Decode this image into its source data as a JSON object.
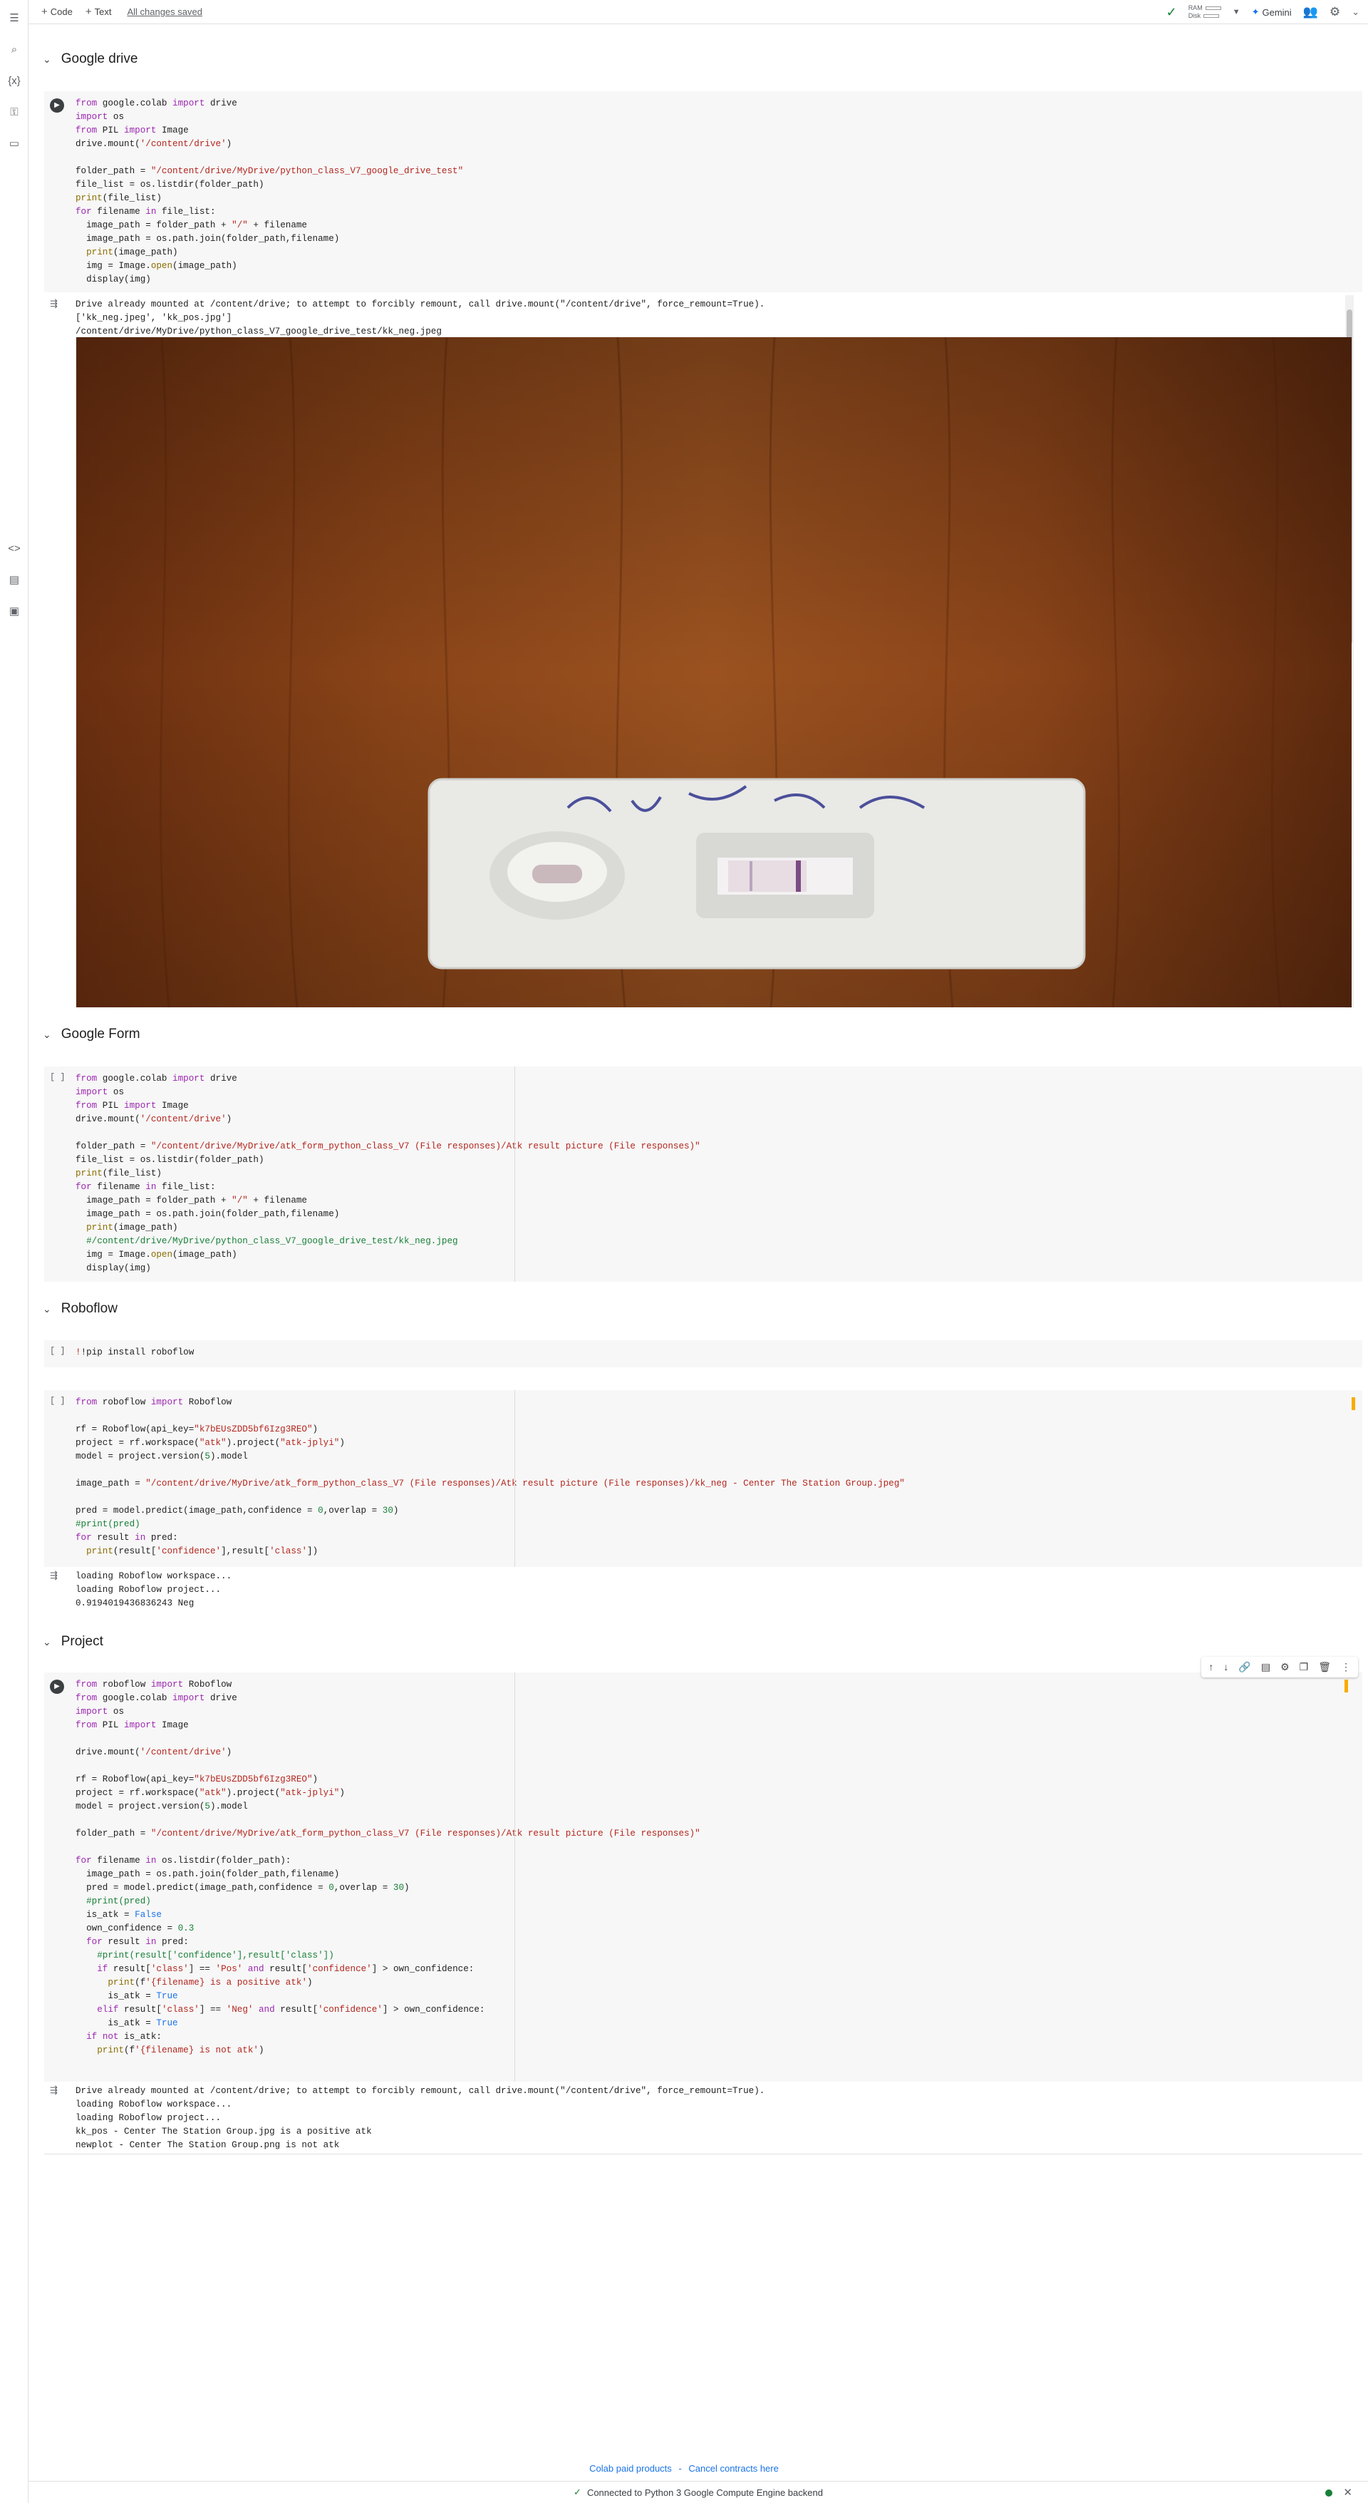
{
  "toolbar": {
    "code_label": "Code",
    "text_label": "Text",
    "saved_status": "All changes saved",
    "ram_label": "RAM",
    "disk_label": "Disk",
    "gemini_label": "Gemini"
  },
  "sections": {
    "google_drive": "Google drive",
    "google_form": "Google Form",
    "roboflow": "Roboflow",
    "project": "Project"
  },
  "cells": {
    "drive_code": [
      "from google.colab import drive",
      "import os",
      "from PIL import Image",
      "drive.mount('/content/drive')",
      "",
      "folder_path = \"/content/drive/MyDrive/python_class_V7_google_drive_test\"",
      "file_list = os.listdir(folder_path)",
      "print(file_list)",
      "for filename in file_list:",
      "  image_path = folder_path + \"/\" + filename",
      "  image_path = os.path.join(folder_path,filename)",
      "  print(image_path)",
      "  img = Image.open(image_path)",
      "  display(img)"
    ],
    "drive_output": [
      "Drive already mounted at /content/drive; to attempt to forcibly remount, call drive.mount(\"/content/drive\", force_remount=True).",
      "['kk_neg.jpeg', 'kk_pos.jpg']",
      "/content/drive/MyDrive/python_class_V7_google_drive_test/kk_neg.jpeg"
    ],
    "form_bracket": "[ ]",
    "form_code": [
      "from google.colab import drive",
      "import os",
      "from PIL import Image",
      "drive.mount('/content/drive')",
      "",
      "folder_path = \"/content/drive/MyDrive/atk_form_python_class_V7 (File responses)/Atk result picture (File responses)\"",
      "file_list = os.listdir(folder_path)",
      "print(file_list)",
      "for filename in file_list:",
      "  image_path = folder_path + \"/\" + filename",
      "  image_path = os.path.join(folder_path,filename)",
      "  print(image_path)",
      "  #/content/drive/MyDrive/python_class_V7_google_drive_test/kk_neg.jpeg",
      "  img = Image.open(image_path)",
      "  display(img)"
    ],
    "pip_bracket": "[ ]",
    "pip_code": "!pip install roboflow",
    "rf_bracket": "[ ]",
    "rf_code": [
      "from roboflow import Roboflow",
      "",
      "rf = Roboflow(api_key=\"k7bEUsZDD5bf6Izg3REO\")",
      "project = rf.workspace(\"atk\").project(\"atk-jplyi\")",
      "model = project.version(5).model",
      "",
      "image_path = \"/content/drive/MyDrive/atk_form_python_class_V7 (File responses)/Atk result picture (File responses)/kk_neg - Center The Station Group.jpeg\"",
      "",
      "pred = model.predict(image_path,confidence = 0,overlap = 30)",
      "#print(pred)",
      "for result in pred:",
      "  print(result['confidence'],result['class'])"
    ],
    "rf_output": [
      "loading Roboflow workspace...",
      "loading Roboflow project...",
      "0.9194019436836243 Neg"
    ],
    "project_code": [
      "from roboflow import Roboflow",
      "from google.colab import drive",
      "import os",
      "from PIL import Image",
      "",
      "drive.mount('/content/drive')",
      "",
      "rf = Roboflow(api_key=\"k7bEUsZDD5bf6Izg3REO\")",
      "project = rf.workspace(\"atk\").project(\"atk-jplyi\")",
      "model = project.version(5).model",
      "",
      "folder_path = \"/content/drive/MyDrive/atk_form_python_class_V7 (File responses)/Atk result picture (File responses)\"",
      "",
      "for filename in os.listdir(folder_path):",
      "  image_path = os.path.join(folder_path,filename)",
      "  pred = model.predict(image_path,confidence = 0,overlap = 30)",
      "  #print(pred)",
      "  is_atk = False",
      "  own_confidence = 0.3",
      "  for result in pred:",
      "    #print(result['confidence'],result['class'])",
      "    if result['class'] == 'Pos' and result['confidence'] > own_confidence:",
      "      print(f'{filename} is a positive atk')",
      "      is_atk = True",
      "    elif result['class'] == 'Neg' and result['confidence'] > own_confidence:",
      "      is_atk = True",
      "  if not is_atk:",
      "    print(f'{filename} is not atk')"
    ],
    "project_output": [
      "Drive already mounted at /content/drive; to attempt to forcibly remount, call drive.mount(\"/content/drive\", force_remount=True).",
      "loading Roboflow workspace...",
      "loading Roboflow project...",
      "kk_pos - Center The Station Group.jpg is a positive atk",
      "newplot - Center The Station Group.png is not atk"
    ]
  },
  "footer": {
    "paid_products": "Colab paid products",
    "separator": "-",
    "cancel_contracts": "Cancel contracts here",
    "status": "Connected to Python 3 Google Compute Engine backend"
  },
  "icons": {
    "rail": [
      "table-of-contents-icon",
      "search-icon",
      "variables-icon",
      "secrets-key-icon",
      "folder-icon",
      "code-snippets-icon",
      "command-palette-icon",
      "terminal-icon"
    ]
  }
}
